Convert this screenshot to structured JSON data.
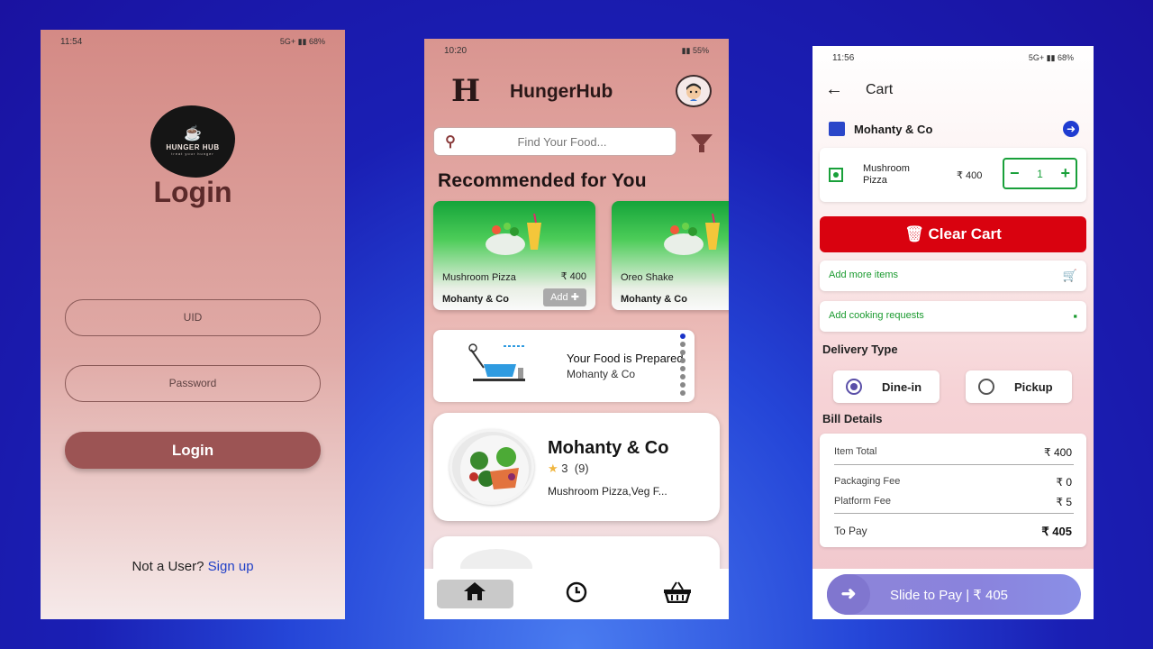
{
  "login_screen": {
    "status": {
      "time": "11:54",
      "battery": "68%",
      "network": "5G+"
    },
    "logo": {
      "name": "HUNGER HUB",
      "tagline": "treat your hunger"
    },
    "title": "Login",
    "uid_placeholder": "UID",
    "password_placeholder": "Password",
    "login_button": "Login",
    "signup_prompt": "Not a User?",
    "signup_link": "Sign up"
  },
  "home_screen": {
    "status": {
      "time": "10:20",
      "battery": "55%"
    },
    "app_title": "HungerHub",
    "logo_glyph": "H",
    "search_placeholder": "Find Your Food...",
    "section_title": "Recommended for You",
    "recommended": [
      {
        "name": "Mushroom Pizza",
        "price": "₹ 400",
        "restaurant": "Mohanty & Co",
        "add_label": "Add"
      },
      {
        "name": "Oreo Shake",
        "price": "",
        "restaurant": "Mohanty & Co",
        "add_label": ""
      }
    ],
    "order_status": {
      "title": "Your Food is Prepared",
      "restaurant": "Mohanty & Co"
    },
    "restaurant_card": {
      "name": "Mohanty & Co",
      "rating": "3",
      "reviews": "(9)",
      "items": "Mushroom Pizza,Veg F..."
    },
    "nav": {
      "home_icon": "home-icon",
      "history_icon": "clock-icon",
      "cart_icon": "basket-icon"
    }
  },
  "cart_screen": {
    "status": {
      "time": "11:56",
      "battery": "68%",
      "network": "5G+"
    },
    "title": "Cart",
    "restaurant": "Mohanty & Co",
    "item": {
      "name": "Mushroom Pizza",
      "price": "₹ 400",
      "quantity": "1"
    },
    "clear_button": "Clear Cart",
    "add_more": "Add more items",
    "cooking_requests": "Add cooking requests",
    "delivery_type_label": "Delivery Type",
    "delivery_options": [
      {
        "label": "Dine-in",
        "selected": true
      },
      {
        "label": "Pickup",
        "selected": false
      }
    ],
    "bill_label": "Bill Details",
    "bill": {
      "item_total_label": "Item Total",
      "item_total": "₹ 400",
      "packaging_label": "Packaging Fee",
      "packaging": "₹ 0",
      "platform_label": "Platform Fee",
      "platform": "₹ 5",
      "to_pay_label": "To Pay",
      "to_pay": "₹ 405"
    },
    "slide_to_pay": "Slide to Pay | ₹ 405"
  },
  "colors": {
    "background": "#1a1fb4",
    "login_button": "#9c5454",
    "clear_cart": "#d9020f",
    "veg_green": "#19a03a",
    "slide_pay": "#8a83dd",
    "link_blue": "#1f3fc7"
  }
}
